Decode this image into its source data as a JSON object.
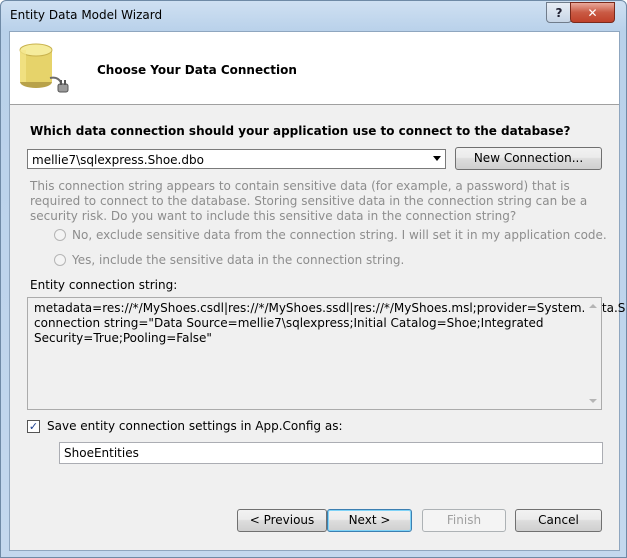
{
  "window": {
    "title": "Entity Data Model Wizard",
    "help_label": "?",
    "close_label": "✕"
  },
  "header": {
    "title": "Choose Your Data Connection",
    "icon": "database-icon"
  },
  "connection": {
    "question": "Which data connection should your application use to connect to the database?",
    "selected": "mellie7\\sqlexpress.Shoe.dbo",
    "new_connection_label": "New Connection..."
  },
  "sensitive": {
    "warning": "This connection string appears to contain sensitive data (for example, a password) that is required to connect to the database. Storing sensitive data in the connection string can be a security risk. Do you want to include this sensitive data in the connection string?",
    "option_no": "No, exclude sensitive data from the connection string. I will set it in my application code.",
    "option_yes": "Yes, include the sensitive data in the connection string."
  },
  "entity_connection": {
    "label": "Entity connection string:",
    "value": "metadata=res://*/MyShoes.csdl|res://*/MyShoes.ssdl|res://*/MyShoes.msl;provider=System.Data.SqlClient;provider connection string=\"Data Source=mellie7\\sqlexpress;Initial Catalog=Shoe;Integrated Security=True;Pooling=False\""
  },
  "save_settings": {
    "checked": true,
    "label": "Save entity connection settings in App.Config as:",
    "name_value": "ShoeEntities"
  },
  "footer": {
    "previous_label": "< Previous",
    "next_label": "Next >",
    "finish_label": "Finish",
    "cancel_label": "Cancel"
  },
  "colors": {
    "disabled_text": "#8d8d8d",
    "title_gradient_top": "#cfe0f2",
    "close_button": "#c95a44"
  }
}
